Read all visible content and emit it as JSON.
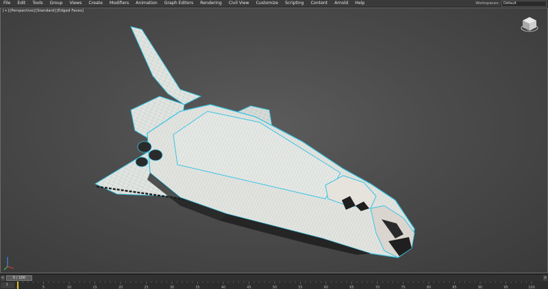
{
  "menubar": {
    "items": [
      "File",
      "Edit",
      "Tools",
      "Group",
      "Views",
      "Create",
      "Modifiers",
      "Animation",
      "Graph Editors",
      "Rendering",
      "Civil View",
      "Customize",
      "Scripting",
      "Content",
      "Arnold",
      "Help"
    ],
    "workspaces_label": "Workspaces:",
    "workspaces_value": "Default"
  },
  "viewport": {
    "labels": [
      "[+]",
      "[Perspective]",
      "[Standard]",
      "[Edged Faces]"
    ],
    "model_colors": {
      "hull": "#e6e2dc",
      "wire": "#38c4e4",
      "dark": "#1f1f1f"
    }
  },
  "timeslider": {
    "position": "0 / 100",
    "prev": "<",
    "next": ">"
  },
  "trackbar": {
    "key_button": "1 ",
    "ticks": [
      "0",
      "5",
      "10",
      "15",
      "20",
      "25",
      "30",
      "35",
      "40",
      "45",
      "50",
      "55",
      "60",
      "65",
      "70",
      "75",
      "80",
      "85",
      "90",
      "95",
      "100"
    ]
  }
}
